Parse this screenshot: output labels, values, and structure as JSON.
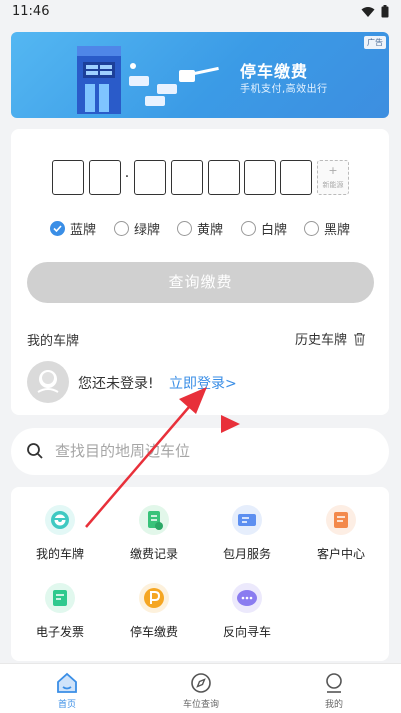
{
  "status_bar": {
    "time": "11:46"
  },
  "banner": {
    "ad_badge": "广告",
    "title": "停车缴费",
    "subtitle": "手机支付,高效出行"
  },
  "plate_input": {
    "new_energy_plus": "+",
    "new_energy_label": "新能源",
    "separator": "·"
  },
  "plate_colors": [
    {
      "label": "蓝牌",
      "checked": true
    },
    {
      "label": "绿牌",
      "checked": false
    },
    {
      "label": "黄牌",
      "checked": false
    },
    {
      "label": "白牌",
      "checked": false
    },
    {
      "label": "黑牌",
      "checked": false
    }
  ],
  "query_button": "查询缴费",
  "my_plate": {
    "title": "我的车牌",
    "history_label": "历史车牌"
  },
  "login": {
    "text": "您还未登录!",
    "link": "立即登录>"
  },
  "search": {
    "placeholder": "查找目的地周边车位"
  },
  "services": [
    {
      "label": "我的车牌",
      "icon": "steering-wheel-icon",
      "color": "#3fc9c2"
    },
    {
      "label": "缴费记录",
      "icon": "receipt-icon",
      "color": "#38c37a"
    },
    {
      "label": "包月服务",
      "icon": "monthly-ticket-icon",
      "color": "#5d8ff0"
    },
    {
      "label": "客户中心",
      "icon": "customer-service-icon",
      "color": "#f3894b"
    },
    {
      "label": "电子发票",
      "icon": "invoice-icon",
      "color": "#2fc98e"
    },
    {
      "label": "停车缴费",
      "icon": "parking-icon",
      "color": "#f5a623"
    },
    {
      "label": "反向寻车",
      "icon": "find-car-icon",
      "color": "#8a7cf0"
    }
  ],
  "tabs": [
    {
      "label": "首页",
      "icon": "home-icon",
      "active": true
    },
    {
      "label": "车位查询",
      "icon": "compass-icon",
      "active": false
    },
    {
      "label": "我的",
      "icon": "user-icon",
      "active": false
    }
  ],
  "colors": {
    "accent": "#3a8ee6",
    "annotation_arrow": "#e8303a",
    "banner": "#3d9be6"
  }
}
